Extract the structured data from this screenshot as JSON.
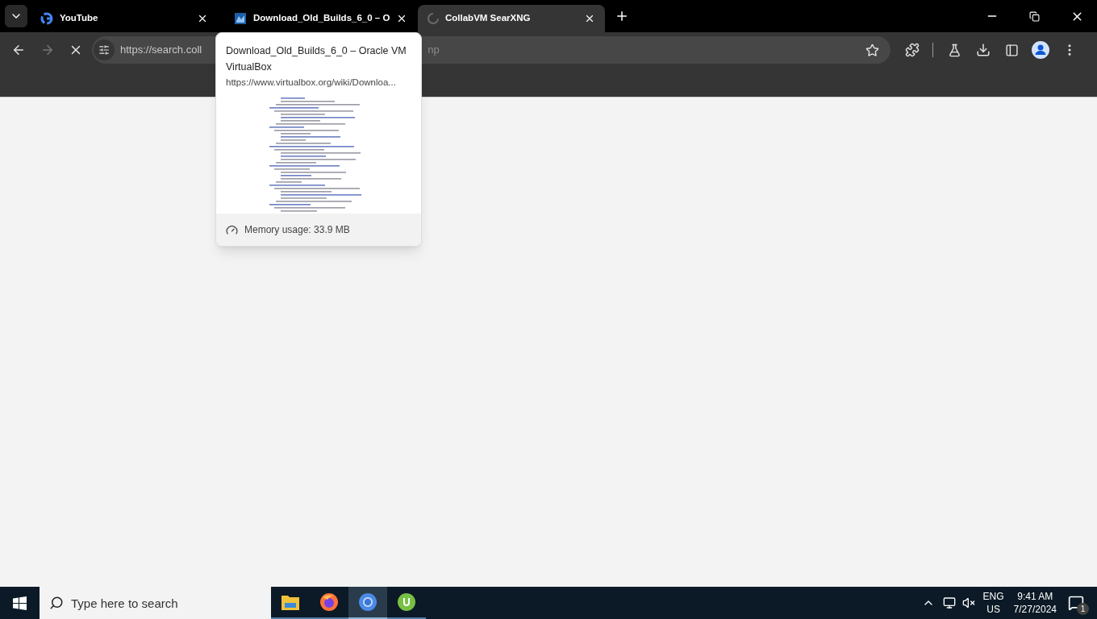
{
  "tabs": [
    {
      "title": "YouTube",
      "kind": "google",
      "selected": false
    },
    {
      "title": "Download_Old_Builds_6_0 – O",
      "kind": "virtualbox",
      "selected": false
    },
    {
      "title": "CollabVM SearXNG",
      "kind": "loading",
      "selected": true
    }
  ],
  "address_bar": {
    "text_start": "https://search.coll",
    "text_end": "np"
  },
  "hover_card": {
    "title": "Download_Old_Builds_6_0 – Oracle VM VirtualBox",
    "url": "https://www.virtualbox.org/wiki/Downloa...",
    "memory": "Memory usage: 33.9 MB"
  },
  "taskbar": {
    "search": {
      "placeholder": "Type here to search"
    },
    "apps": [
      {
        "kind": "files",
        "selected": false
      },
      {
        "kind": "firefox",
        "selected": false
      },
      {
        "kind": "chrome",
        "selected": true
      },
      {
        "kind": "utorrent",
        "selected": false
      }
    ],
    "language": "ENG",
    "region": "US",
    "time": "9:41 AM",
    "date": "7/27/2024",
    "notifications": "1"
  }
}
